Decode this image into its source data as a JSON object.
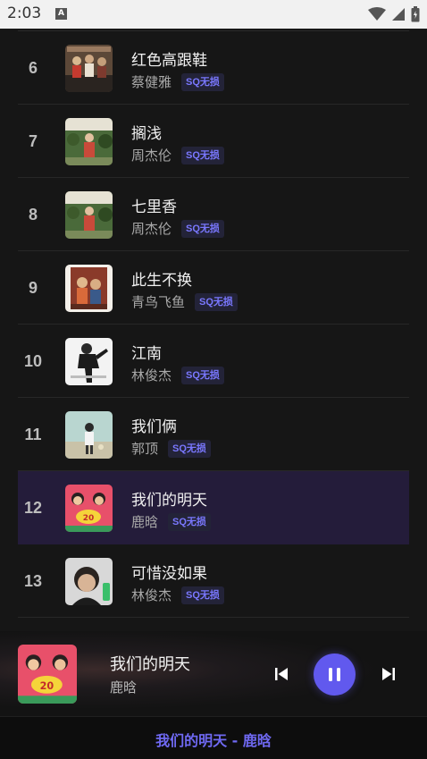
{
  "status_bar": {
    "time": "2:03",
    "app_icon_letter": "A",
    "icons": [
      "wifi-icon",
      "signal-icon",
      "battery-icon"
    ]
  },
  "tracks": [
    {
      "index": "6",
      "title": "红色高跟鞋",
      "artist": "蔡健雅",
      "quality": "SQ无损",
      "active": false
    },
    {
      "index": "7",
      "title": "搁浅",
      "artist": "周杰伦",
      "quality": "SQ无损",
      "active": false
    },
    {
      "index": "8",
      "title": "七里香",
      "artist": "周杰伦",
      "quality": "SQ无损",
      "active": false
    },
    {
      "index": "9",
      "title": "此生不换",
      "artist": "青鸟飞鱼",
      "quality": "SQ无损",
      "active": false
    },
    {
      "index": "10",
      "title": "江南",
      "artist": "林俊杰",
      "quality": "SQ无损",
      "active": false
    },
    {
      "index": "11",
      "title": "我们俩",
      "artist": "郭顶",
      "quality": "SQ无损",
      "active": false
    },
    {
      "index": "12",
      "title": "我们的明天",
      "artist": "鹿晗",
      "quality": "SQ无损",
      "active": true
    },
    {
      "index": "13",
      "title": "可惜没如果",
      "artist": "林俊杰",
      "quality": "SQ无损",
      "active": false
    }
  ],
  "player": {
    "title": "我们的明天",
    "artist": "鹿晗",
    "prev_icon": "skip-previous-icon",
    "play_icon": "pause-icon",
    "next_icon": "skip-next-icon"
  },
  "lyric_bar": {
    "text": "我们的明天 - 鹿晗"
  },
  "colors": {
    "accent": "#6159ee",
    "badge_text": "#7a78ff",
    "active_row": "#241c3a",
    "background": "#161616"
  }
}
